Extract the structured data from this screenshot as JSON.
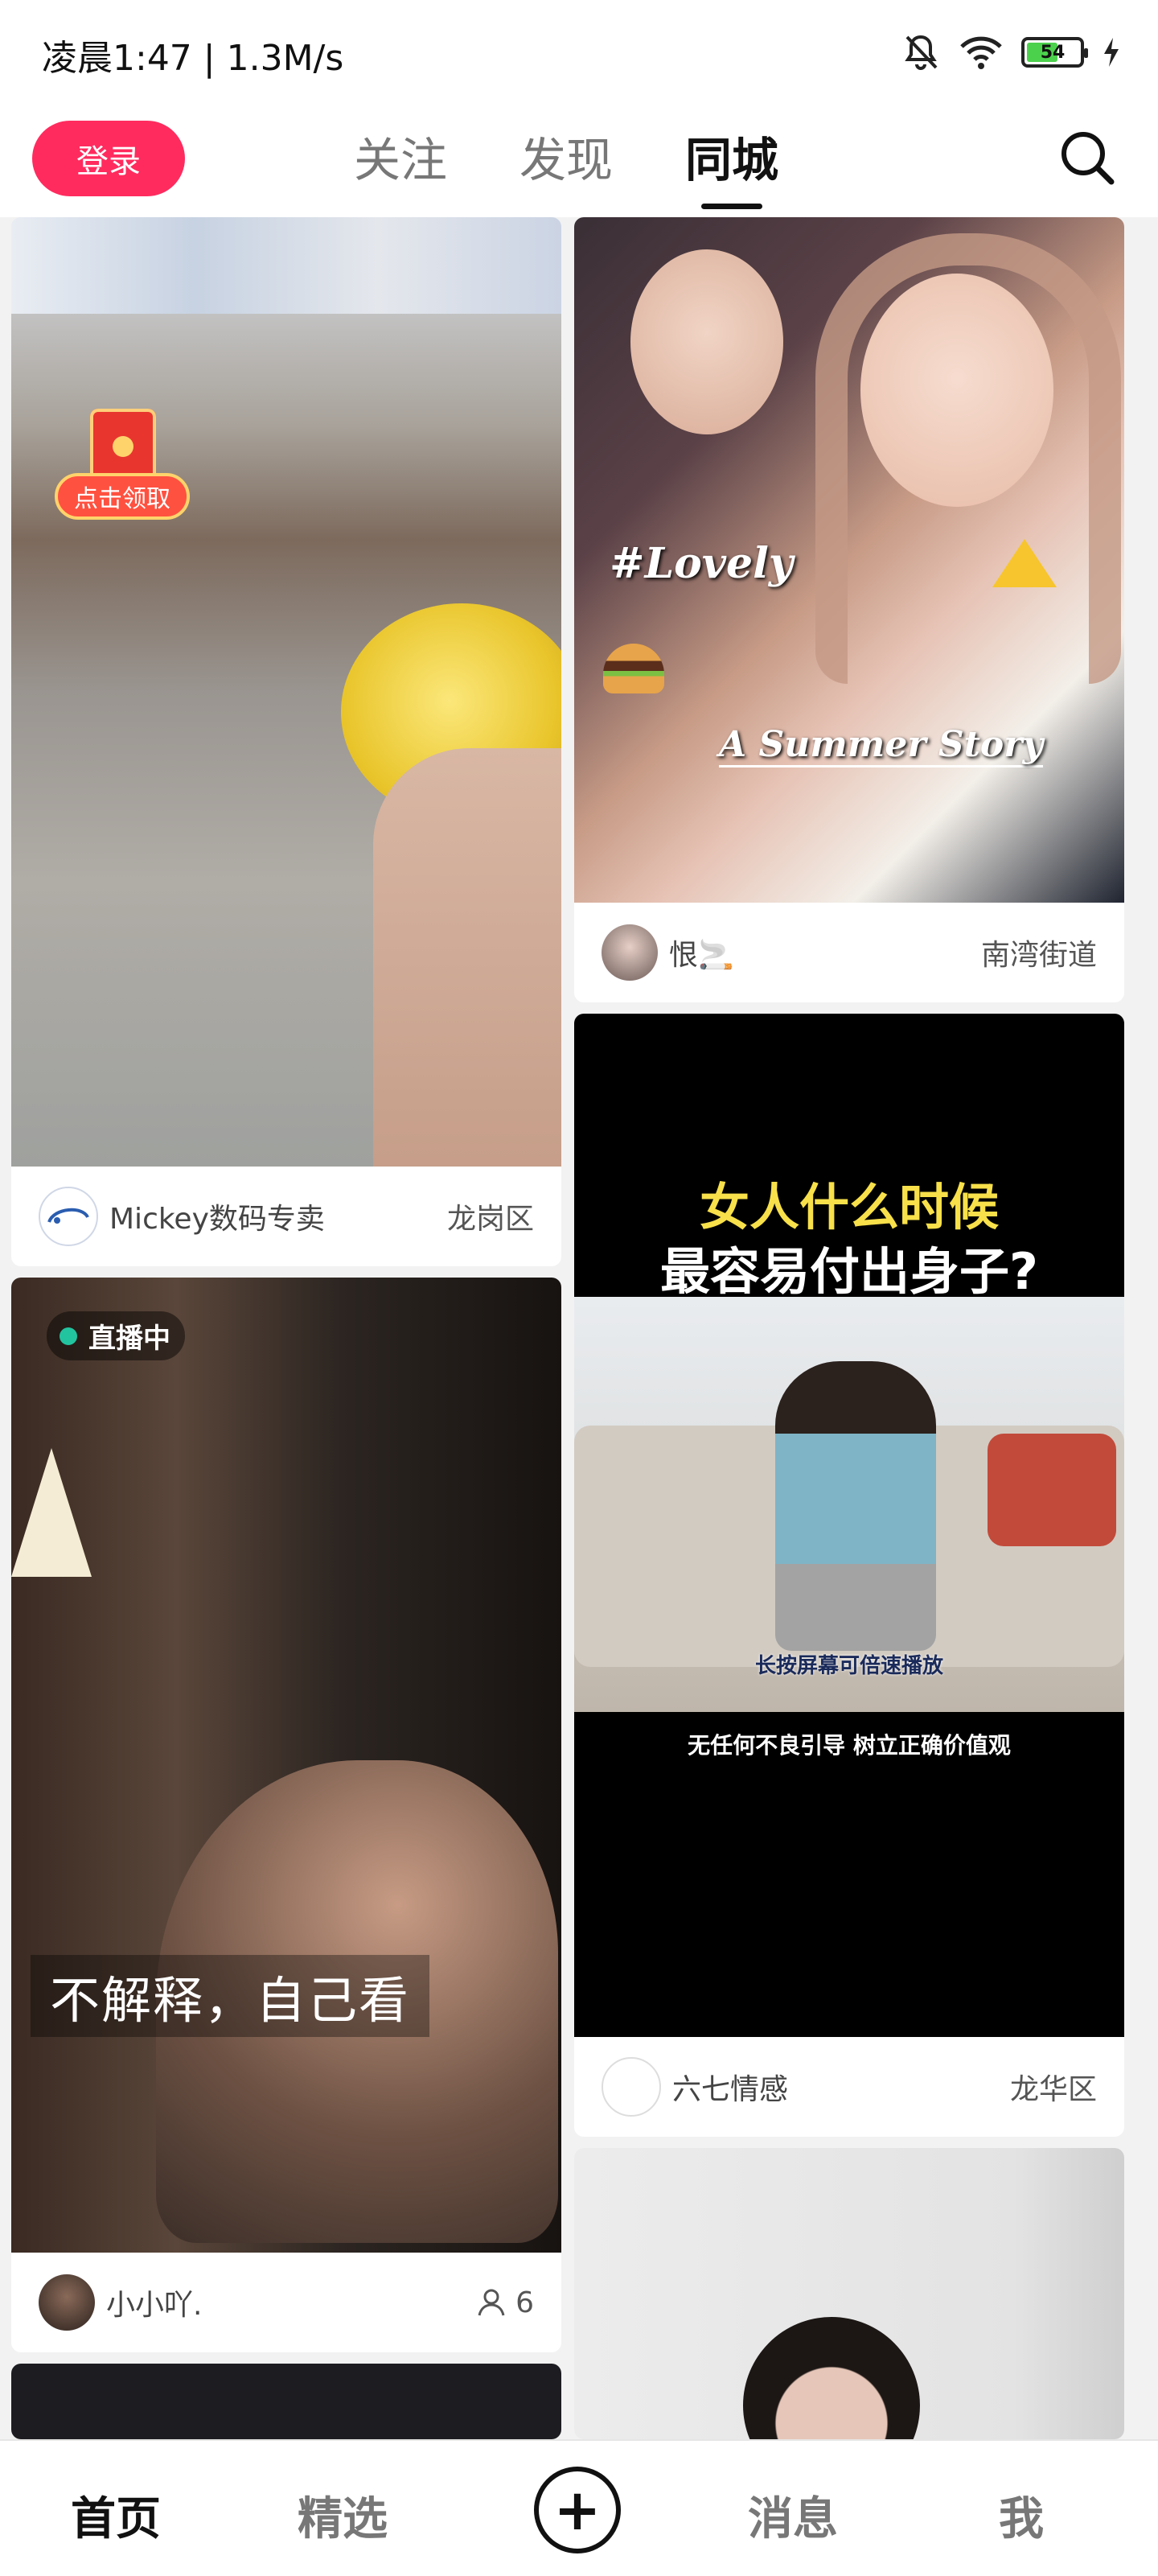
{
  "status": {
    "time": "凌晨1:47 | 1.3M/s",
    "battery": "54"
  },
  "nav": {
    "login": "登录",
    "tabs": [
      {
        "label": "关注"
      },
      {
        "label": "发现"
      },
      {
        "label": "同城"
      }
    ],
    "active_tab": "同城"
  },
  "feed": [
    {
      "author": "Mickey数码专卖",
      "location": "龙岗区",
      "badge": "点击领取"
    },
    {
      "author": "恨🚬",
      "location": "南湾街道",
      "overlay": [
        "#Lovely",
        "A Summer Story"
      ]
    },
    {
      "live": "直播中",
      "caption": "不解释，自己看",
      "author": "小小吖.",
      "viewers": "6"
    },
    {
      "headline_line1": "女人什么时候",
      "headline_line2": "最容易付出身子?",
      "subtitle": "长按屏幕可倍速播放",
      "notice": "无任何不良引导 树立正确价值观",
      "author": "六七情感",
      "location": "龙华区"
    }
  ],
  "bottom_nav": {
    "home": "首页",
    "featured": "精选",
    "plus": "+",
    "messages": "消息",
    "me": "我"
  },
  "colors": {
    "accent": "#ff2b5e",
    "live_dot": "#22c4a0",
    "headline_yellow": "#f7e04a"
  }
}
